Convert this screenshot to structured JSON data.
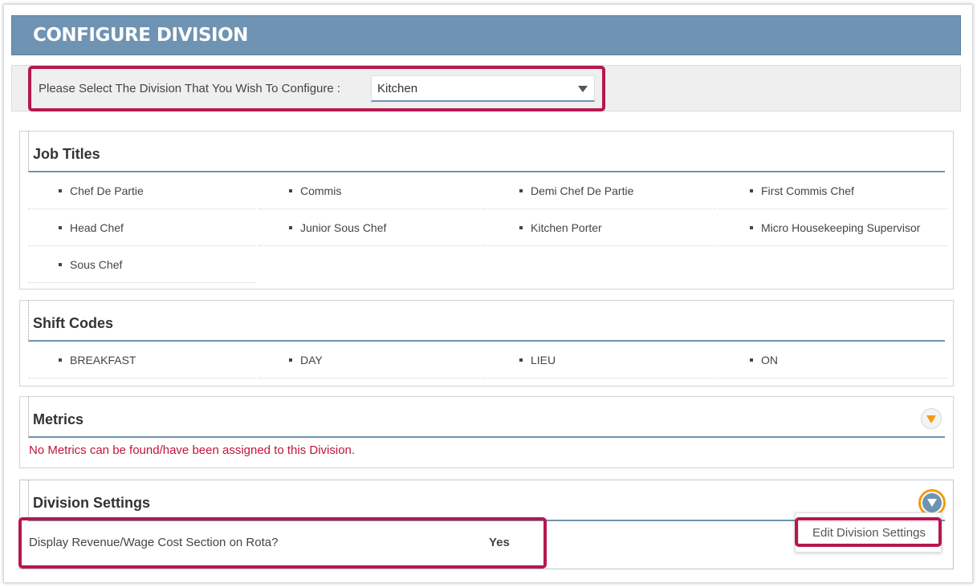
{
  "header": {
    "title": "CONFIGURE DIVISION"
  },
  "division_select": {
    "label": "Please Select The Division That You Wish To Configure :",
    "value": "Kitchen"
  },
  "job_titles": {
    "title": "Job Titles",
    "items": [
      "Chef De Partie",
      "Commis",
      "Demi Chef De Partie",
      "First Commis Chef",
      "Head Chef",
      "Junior Sous Chef",
      "Kitchen Porter",
      "Micro Housekeeping Supervisor",
      "Sous Chef"
    ]
  },
  "shift_codes": {
    "title": "Shift Codes",
    "items": [
      "BREAKFAST",
      "DAY",
      "LIEU",
      "ON"
    ]
  },
  "metrics": {
    "title": "Metrics",
    "empty_message": "No Metrics can be found/have been assigned to this Division."
  },
  "division_settings": {
    "title": "Division Settings",
    "setting_label": "Display Revenue/Wage Cost Section on Rota?",
    "setting_value": "Yes",
    "menu_item": "Edit Division Settings"
  },
  "colors": {
    "header": "#6f93b2",
    "highlight": "#b5184f",
    "accent": "#f39c12",
    "error_text": "#c0143c"
  }
}
